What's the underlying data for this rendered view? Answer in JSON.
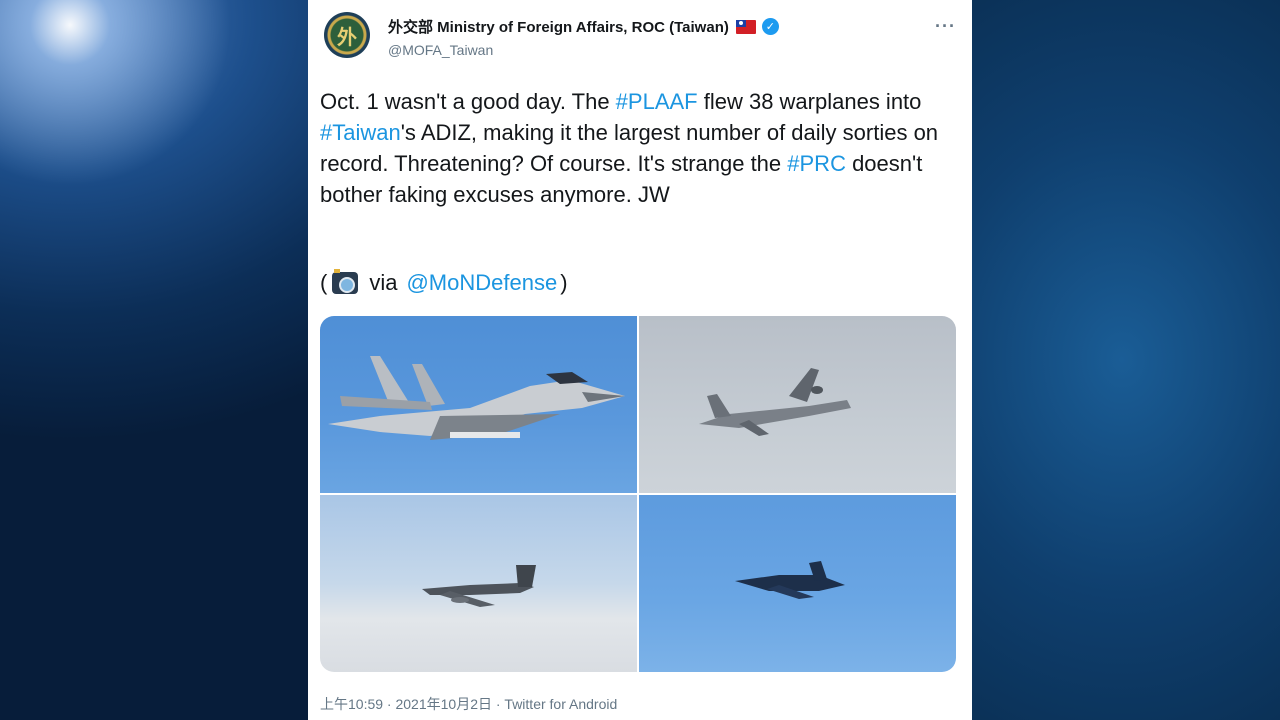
{
  "tweet": {
    "author": {
      "display_name": "外交部 Ministry of Foreign Affairs, ROC (Taiwan)",
      "handle": "@MOFA_Taiwan",
      "avatar_text": "外"
    },
    "more_label": "···",
    "text": {
      "seg1": "Oct. 1 wasn't a good day. The ",
      "tag1": "#PLAAF",
      "seg2": " flew 38 warplanes into ",
      "tag2": "#Taiwan",
      "seg3": "'s ADIZ, making it the largest number of daily sorties on record. Threatening? Of course. It's strange the ",
      "tag3": "#PRC",
      "seg4": " doesn't bother faking excuses anymore. JW"
    },
    "via": {
      "open_paren": "(",
      "word": "via",
      "mention": "@MoNDefense",
      "close_paren": ")"
    },
    "photos": [
      {
        "icon": "fighter-jet-photo"
      },
      {
        "icon": "patrol-aircraft-photo"
      },
      {
        "icon": "bomber-photo"
      },
      {
        "icon": "fighter-distant-photo"
      }
    ],
    "footer": "上午10:59 · 2021年10月2日 · Twitter for Android"
  }
}
